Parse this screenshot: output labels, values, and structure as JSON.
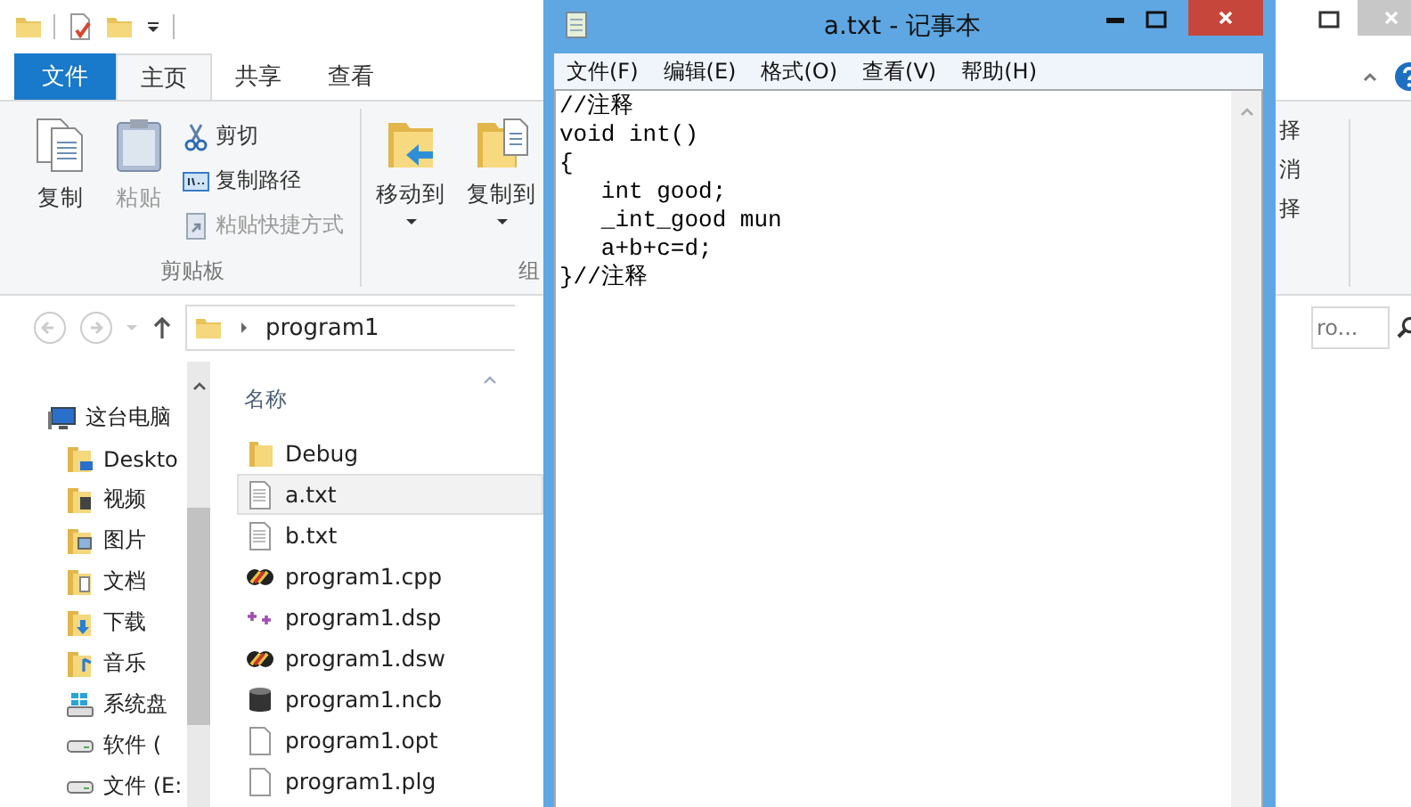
{
  "explorer": {
    "tabs": [
      {
        "label": "文件",
        "kind": "file",
        "selected": false
      },
      {
        "label": "主页",
        "kind": "tab",
        "selected": true
      },
      {
        "label": "共享",
        "kind": "tab",
        "selected": false
      },
      {
        "label": "查看",
        "kind": "tab",
        "selected": false
      }
    ],
    "clipboard_group": {
      "label": "剪贴板",
      "large_buttons": [
        {
          "label": "复制",
          "kind": "copy",
          "disabled": false
        },
        {
          "label": "粘贴",
          "kind": "paste",
          "disabled": true
        }
      ],
      "small_buttons": [
        {
          "label": "剪切",
          "kind": "cut",
          "disabled": false
        },
        {
          "label": "复制路径",
          "kind": "path",
          "disabled": false
        },
        {
          "label": "粘贴快捷方式",
          "kind": "shortcut",
          "disabled": true
        }
      ]
    },
    "organize_group": {
      "label": "组",
      "large_buttons": [
        {
          "label": "移动到",
          "kind": "move"
        },
        {
          "label": "复制到",
          "kind": "copyto"
        }
      ]
    },
    "right_fragments": [
      "择",
      "消",
      "择"
    ],
    "address": {
      "path": "program1"
    },
    "search": {
      "placeholder": "ro..."
    },
    "nav_pane": [
      {
        "label": "这台电脑",
        "kind": "computer",
        "children": [
          {
            "label": "Deskto",
            "kind": "desktop"
          },
          {
            "label": "视频",
            "kind": "video"
          },
          {
            "label": "图片",
            "kind": "picture"
          },
          {
            "label": "文档",
            "kind": "document"
          },
          {
            "label": "下载",
            "kind": "download"
          },
          {
            "label": "音乐",
            "kind": "music"
          },
          {
            "label": "系统盘",
            "kind": "system"
          },
          {
            "label": "软件 (",
            "kind": "drive"
          },
          {
            "label": "文件 (E:",
            "kind": "drive"
          }
        ]
      }
    ],
    "column": "名称",
    "files": [
      {
        "name": "Debug",
        "kind": "folder",
        "selected": false
      },
      {
        "name": "a.txt",
        "kind": "text",
        "selected": true
      },
      {
        "name": "b.txt",
        "kind": "text",
        "selected": false
      },
      {
        "name": "program1.cpp",
        "kind": "vc",
        "selected": false
      },
      {
        "name": "program1.dsp",
        "kind": "dsp",
        "selected": false
      },
      {
        "name": "program1.dsw",
        "kind": "vc",
        "selected": false
      },
      {
        "name": "program1.ncb",
        "kind": "db",
        "selected": false
      },
      {
        "name": "program1.opt",
        "kind": "blank",
        "selected": false
      },
      {
        "name": "program1.plg",
        "kind": "blank",
        "selected": false
      }
    ]
  },
  "notepad": {
    "title": "a.txt - 记事本",
    "menu": [
      "文件(F)",
      "编辑(E)",
      "格式(O)",
      "查看(V)",
      "帮助(H)"
    ],
    "lines": [
      "//注释",
      "void int()",
      "{",
      "   int good;",
      "   _int_good mun",
      "   a+b+c=d;",
      "}//注释"
    ]
  }
}
